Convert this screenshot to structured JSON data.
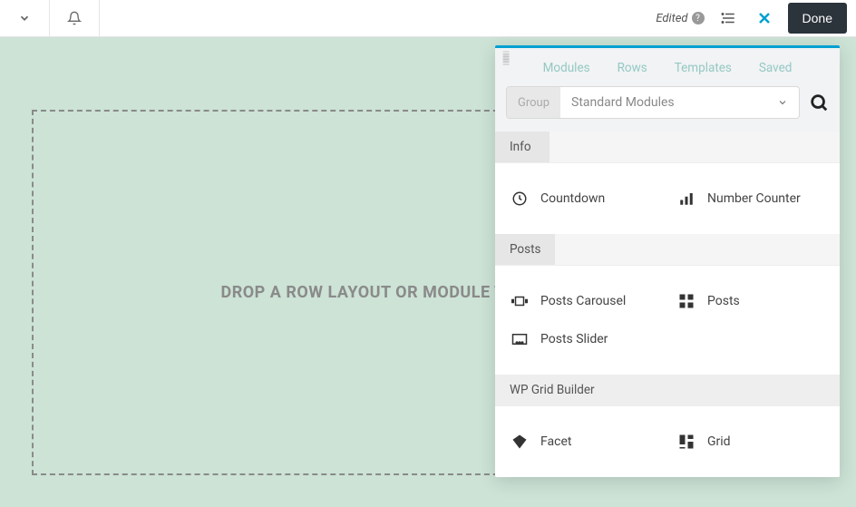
{
  "topbar": {
    "edited_label": "Edited",
    "done_label": "Done"
  },
  "canvas": {
    "dropzone_text": "DROP A ROW LAYOUT OR MODULE TO GET STARTED!"
  },
  "panel": {
    "tabs": [
      "Modules",
      "Rows",
      "Templates",
      "Saved"
    ],
    "filter": {
      "group_label": "Group",
      "select_value": "Standard Modules"
    },
    "sections": [
      {
        "title": "Info",
        "modules": [
          {
            "name": "Countdown",
            "icon": "clock"
          },
          {
            "name": "Number Counter",
            "icon": "bars"
          }
        ]
      },
      {
        "title": "Posts",
        "modules": [
          {
            "name": "Posts Carousel",
            "icon": "carousel"
          },
          {
            "name": "Posts",
            "icon": "grid4"
          },
          {
            "name": "Posts Slider",
            "icon": "slider"
          }
        ]
      },
      {
        "title": "WP Grid Builder",
        "full": true,
        "modules": [
          {
            "name": "Facet",
            "icon": "diamond"
          },
          {
            "name": "Grid",
            "icon": "grid2"
          }
        ]
      }
    ]
  }
}
